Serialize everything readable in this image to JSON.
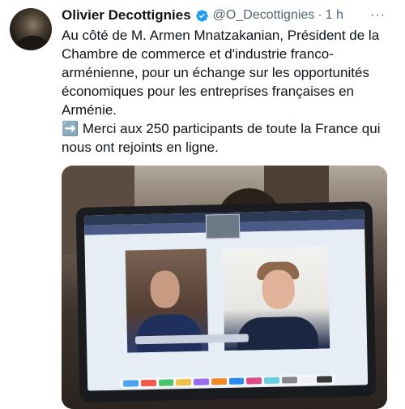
{
  "tweet": {
    "author_name": "Olivier Decottignies",
    "handle": "@O_Decottignies",
    "separator": "·",
    "time": "1 h",
    "more_label": "···",
    "text": "Au côté de M. Armen Mnatzakanian, Président de la Chambre de commerce et d'industrie franco-arménienne, pour un échange sur les opportunités économiques pour les entreprises françaises en Arménie.\n➡️ Merci aux 250 participants de toute la France qui nous ont rejoints en ligne."
  },
  "icons": {
    "verified": "verified-badge-icon",
    "more": "more-horizontal-icon"
  },
  "colors": {
    "verified": "#1d9bf0",
    "secondary_text": "#536471",
    "primary_text": "#0f1419"
  }
}
